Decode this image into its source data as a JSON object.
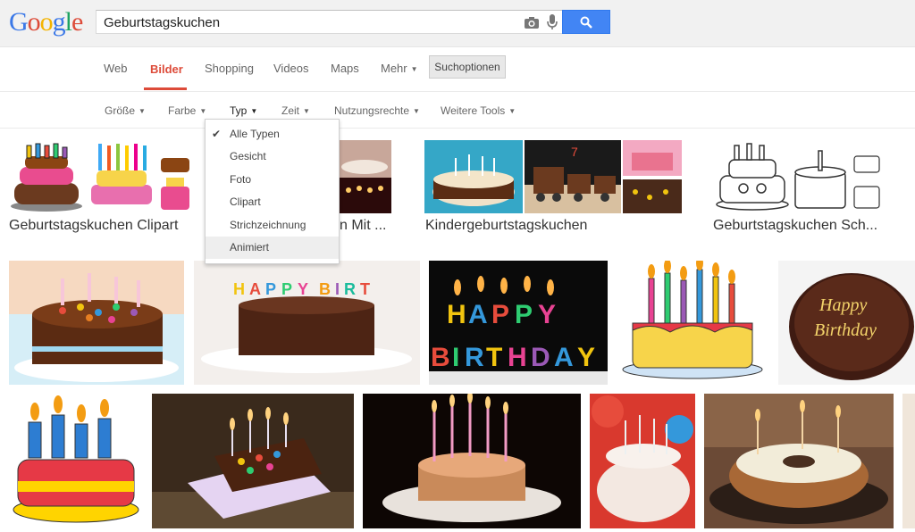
{
  "search": {
    "query": "Geburtstagskuchen"
  },
  "logo": {
    "letters": [
      "G",
      "o",
      "o",
      "g",
      "l",
      "e"
    ],
    "colors": [
      "#3b78e7",
      "#dd4b39",
      "#f4b400",
      "#3b78e7",
      "#1ea362",
      "#dd4b39"
    ]
  },
  "nav": {
    "items": [
      "Web",
      "Bilder",
      "Shopping",
      "Videos",
      "Maps",
      "Mehr"
    ],
    "active": "Bilder",
    "suchoptionen": "Suchoptionen"
  },
  "tools": {
    "items": [
      "Größe",
      "Farbe",
      "Typ",
      "Zeit",
      "Nutzungsrechte",
      "Weitere Tools"
    ]
  },
  "type_menu": {
    "options": [
      "Alle Typen",
      "Gesicht",
      "Foto",
      "Clipart",
      "Strichzeichnung",
      "Animiert"
    ],
    "selected": "Alle Typen",
    "highlighted": "Animiert"
  },
  "groups": [
    {
      "label": "Geburtstagskuchen Clipart"
    },
    {
      "label": "n Mit ..."
    },
    {
      "label": "Kindergeburtstagskuchen"
    },
    {
      "label": "Geburtstagskuchen Sch..."
    }
  ],
  "colors": {
    "accent_red": "#dd4b39",
    "search_blue": "#4285f4"
  }
}
